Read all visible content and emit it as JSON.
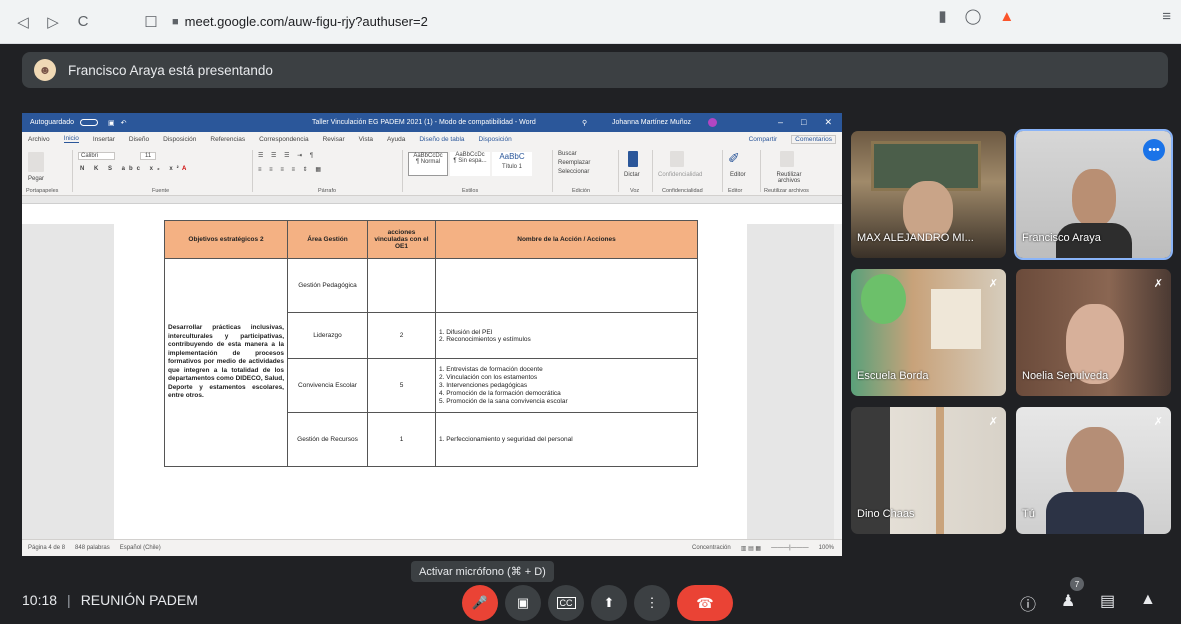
{
  "browser": {
    "url": "meet.google.com/auw-figu-rjy?authuser=2",
    "back_icon": "◁",
    "forward_icon": "▷",
    "reload_icon": "C",
    "bookmark_icon": "☐",
    "lock_icon": "🔒",
    "menu_icon": "≡"
  },
  "banner": {
    "text": "Francisco Araya está presentando"
  },
  "word": {
    "autosave": "Autoguardado",
    "title": "Taller Vinculación EG PADEM 2021 (1) - Modo de compatibilidad - Word",
    "user": "Johanna Martínez Muñoz",
    "tabs": [
      "Archivo",
      "Inicio",
      "Insertar",
      "Diseño",
      "Disposición",
      "Referencias",
      "Correspondencia",
      "Revisar",
      "Vista",
      "Ayuda",
      "Diseño de tabla",
      "Disposición"
    ],
    "share": "Compartir",
    "comments": "Comentarios",
    "groups": [
      "Portapapeles",
      "Fuente",
      "Párrafo",
      "Estilos",
      "Edición",
      "Voz",
      "Confidencialidad",
      "Editor",
      "Reutilizar archivos"
    ],
    "font": "Calibri",
    "size": "11",
    "paste": "Pegar",
    "styles": [
      "AaBbCcDc",
      "AaBbCcDc",
      "AaBbC"
    ],
    "style_names": [
      "¶ Normal",
      "¶ Sin espa...",
      "Título 1"
    ],
    "edit_items": [
      "Buscar",
      "Reemplazar",
      "Seleccionar"
    ],
    "dictate": "Dictar",
    "sensitivity": "Confidencialidad",
    "editor": "Editor",
    "reuse": "Reutilizar archivos",
    "status_left": [
      "Página 4 de 8",
      "848 palabras",
      "Español (Chile)"
    ],
    "status_right": [
      "Concentración",
      "100%"
    ]
  },
  "table": {
    "headers": [
      "Objetivos estratégicos 2",
      "Área Gestión",
      "acciones vinculadas con el OE1",
      "Nombre de la Acción / Acciones"
    ],
    "objective": "Desarrollar prácticas inclusivas, interculturales y participativas, contribuyendo de esta manera a la implementación de procesos formativos por medio de actividades que integren a la totalidad de los departamentos como DIDECO, Salud, Deporte y estamentos escolares, entre otros.",
    "rows": [
      {
        "area": "Gestión Pedagógica",
        "count": "",
        "actions": []
      },
      {
        "area": "Liderazgo",
        "count": "2",
        "actions": [
          "1. Difusión del PEI",
          "2. Reconocimientos y estímulos"
        ]
      },
      {
        "area": "Convivencia Escolar",
        "count": "5",
        "actions": [
          "1. Entrevistas de formación docente",
          "2. Vinculación con los estamentos",
          "3. Intervenciones pedagógicas",
          "4. Promoción de la formación democrática",
          "5. Promoción de la sana convivencia escolar"
        ]
      },
      {
        "area": "Gestión de Recursos",
        "count": "1",
        "actions": [
          "1. Perfeccionamiento y seguridad del personal"
        ]
      }
    ]
  },
  "participants": [
    {
      "name": "MAX ALEJANDRO MI...",
      "muted": false
    },
    {
      "name": "Francisco Araya",
      "muted": false
    },
    {
      "name": "Escuela Borda",
      "muted": true
    },
    {
      "name": "Noelia Sepulveda",
      "muted": true
    },
    {
      "name": "Dino Chaas",
      "muted": true
    },
    {
      "name": "Tú",
      "muted": true
    }
  ],
  "bottom": {
    "time": "10:18",
    "separator": "|",
    "meeting": "REUNIÓN PADEM",
    "tooltip": "Activar micrófono (⌘ + D)",
    "people_count": "7"
  },
  "colors": {
    "hangup": "#ea4335",
    "active_border": "#8ab4f8",
    "word_blue": "#2b579a",
    "table_header": "#f4b183"
  }
}
